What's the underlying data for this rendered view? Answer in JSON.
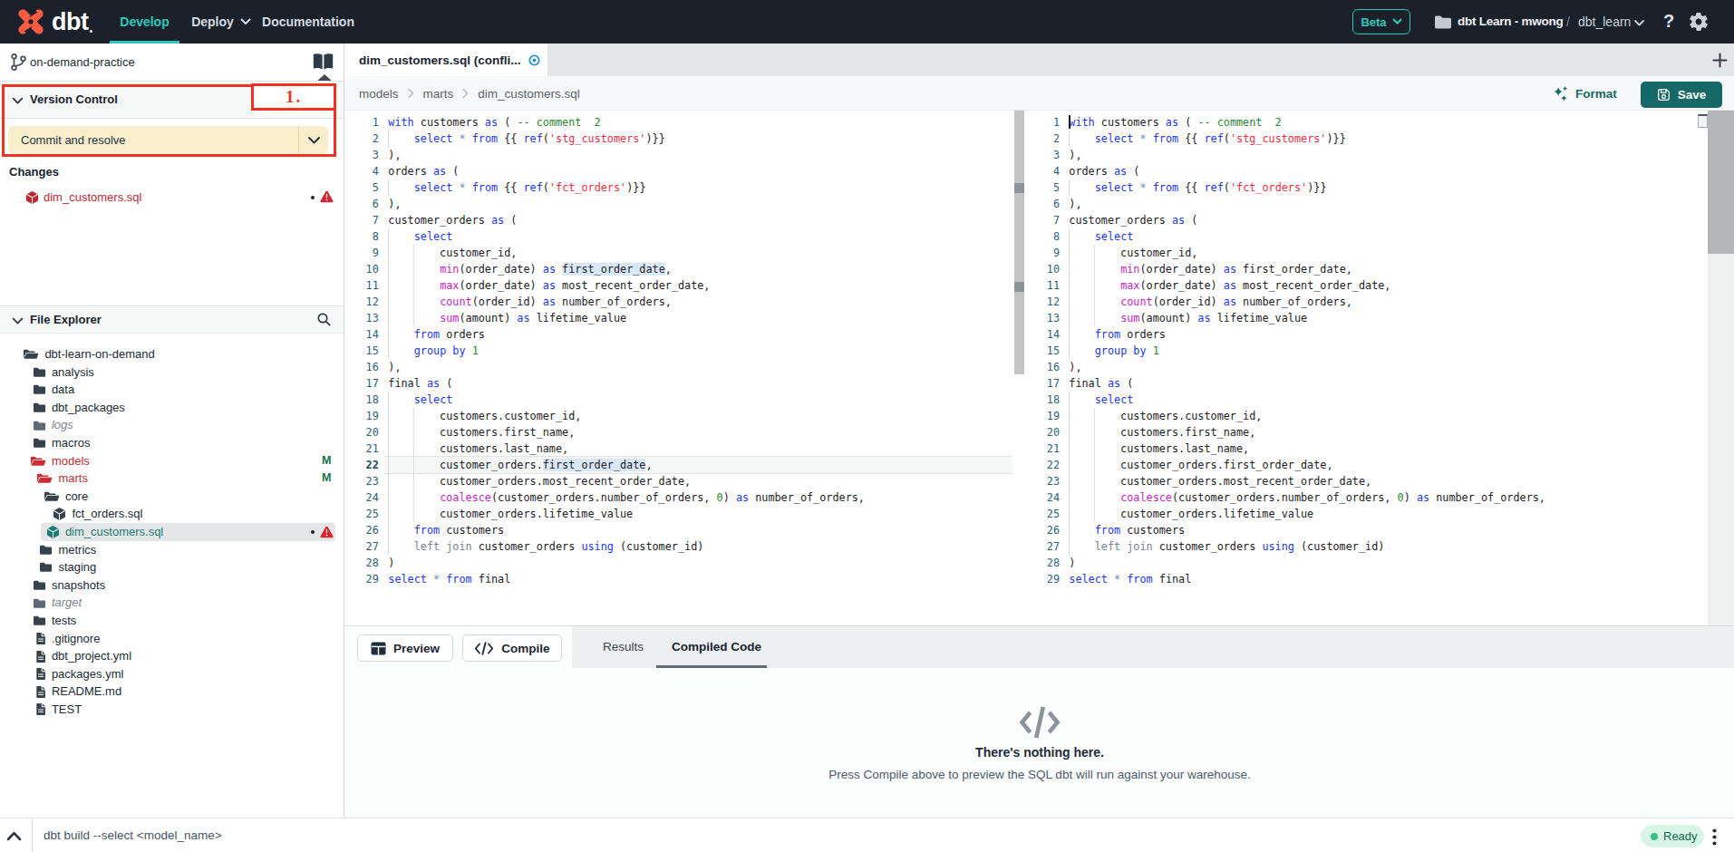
{
  "topbar": {
    "brand": "dbt",
    "nav": [
      {
        "label": "Develop"
      },
      {
        "label": "Deploy"
      },
      {
        "label": "Documentation"
      }
    ],
    "beta_label": "Beta",
    "account": "dbt Learn - mwong",
    "path_separator": "/",
    "project": "dbt_learn",
    "help_glyph": "?"
  },
  "sidebar": {
    "branch": "on-demand-practice",
    "version_control": {
      "title": "Version Control",
      "commit_button": "Commit and resolve",
      "changes_label": "Changes",
      "changed_file": "dim_customers.sql"
    },
    "annotation": {
      "label": "1.",
      "color": "#ee3322"
    },
    "file_explorer": {
      "title": "File Explorer",
      "tree": [
        {
          "name": "dbt-learn-on-demand",
          "depth": 0,
          "icon": "folder-open",
          "style": "default"
        },
        {
          "name": "analysis",
          "depth": 1,
          "icon": "folder",
          "style": "default"
        },
        {
          "name": "data",
          "depth": 1,
          "icon": "folder",
          "style": "default"
        },
        {
          "name": "dbt_packages",
          "depth": 1,
          "icon": "folder",
          "style": "default"
        },
        {
          "name": "logs",
          "depth": 1,
          "icon": "folder",
          "style": "muted"
        },
        {
          "name": "macros",
          "depth": 1,
          "icon": "folder",
          "style": "default"
        },
        {
          "name": "models",
          "depth": 1,
          "icon": "folder-open",
          "style": "red",
          "badge": "M"
        },
        {
          "name": "marts",
          "depth": 2,
          "icon": "folder-open",
          "style": "red",
          "badge": "M"
        },
        {
          "name": "core",
          "depth": 3,
          "icon": "folder-open",
          "style": "default"
        },
        {
          "name": "fct_orders.sql",
          "depth": 4,
          "icon": "cube",
          "style": "default"
        },
        {
          "name": "dim_customers.sql",
          "depth": 3,
          "icon": "cube",
          "style": "selected",
          "markers": true
        },
        {
          "name": "metrics",
          "depth": 2,
          "icon": "folder",
          "style": "default"
        },
        {
          "name": "staging",
          "depth": 2,
          "icon": "folder",
          "style": "default"
        },
        {
          "name": "snapshots",
          "depth": 1,
          "icon": "folder",
          "style": "default"
        },
        {
          "name": "target",
          "depth": 1,
          "icon": "folder",
          "style": "muted"
        },
        {
          "name": "tests",
          "depth": 1,
          "icon": "folder",
          "style": "default"
        },
        {
          "name": ".gitignore",
          "depth": 1,
          "icon": "file",
          "style": "default"
        },
        {
          "name": "dbt_project.yml",
          "depth": 1,
          "icon": "file",
          "style": "default"
        },
        {
          "name": "packages.yml",
          "depth": 1,
          "icon": "file",
          "style": "default"
        },
        {
          "name": "README.md",
          "depth": 1,
          "icon": "file",
          "style": "default"
        },
        {
          "name": "TEST",
          "depth": 1,
          "icon": "file",
          "style": "default"
        }
      ]
    }
  },
  "main": {
    "tab_title": "dim_customers.sql (confli...",
    "breadcrumbs": [
      "models",
      "marts",
      "dim_customers.sql"
    ],
    "format_label": "Format",
    "save_label": "Save"
  },
  "editor": {
    "active_line": 22,
    "cursor_line": 1,
    "lines": [
      [
        [
          "k",
          "with"
        ],
        [
          "p",
          " customers "
        ],
        [
          "k",
          "as"
        ],
        [
          "p",
          " ( "
        ],
        [
          "c",
          "-- comment  2"
        ]
      ],
      [
        [
          "p",
          "    "
        ],
        [
          "k",
          "select"
        ],
        [
          "p",
          " "
        ],
        [
          "o",
          "*"
        ],
        [
          "p",
          " "
        ],
        [
          "k",
          "from"
        ],
        [
          "p",
          " {{ "
        ],
        [
          "k",
          "ref"
        ],
        [
          "p",
          "("
        ],
        [
          "s",
          "'stg_customers'"
        ],
        [
          "p",
          ")}}"
        ]
      ],
      [
        [
          "p",
          "),"
        ]
      ],
      [
        [
          "p",
          "orders "
        ],
        [
          "k",
          "as"
        ],
        [
          "p",
          " ("
        ]
      ],
      [
        [
          "p",
          "    "
        ],
        [
          "k",
          "select"
        ],
        [
          "p",
          " "
        ],
        [
          "o",
          "*"
        ],
        [
          "p",
          " "
        ],
        [
          "k",
          "from"
        ],
        [
          "p",
          " {{ "
        ],
        [
          "k",
          "ref"
        ],
        [
          "p",
          "("
        ],
        [
          "s",
          "'fct_orders'"
        ],
        [
          "p",
          ")}}"
        ]
      ],
      [
        [
          "p",
          "),"
        ]
      ],
      [
        [
          "p",
          "customer_orders "
        ],
        [
          "k",
          "as"
        ],
        [
          "p",
          " ("
        ]
      ],
      [
        [
          "p",
          "    "
        ],
        [
          "k",
          "select"
        ]
      ],
      [
        [
          "p",
          "        customer_id,"
        ]
      ],
      [
        [
          "p",
          "        "
        ],
        [
          "f",
          "min"
        ],
        [
          "p",
          "(order_date) "
        ],
        [
          "k",
          "as"
        ],
        [
          "p",
          " "
        ],
        [
          "h",
          "first_order_date"
        ],
        [
          "p",
          ","
        ]
      ],
      [
        [
          "p",
          "        "
        ],
        [
          "f",
          "max"
        ],
        [
          "p",
          "(order_date) "
        ],
        [
          "k",
          "as"
        ],
        [
          "p",
          " most_recent_order_date,"
        ]
      ],
      [
        [
          "p",
          "        "
        ],
        [
          "f",
          "count"
        ],
        [
          "p",
          "(order_id) "
        ],
        [
          "k",
          "as"
        ],
        [
          "p",
          " number_of_orders,"
        ]
      ],
      [
        [
          "p",
          "        "
        ],
        [
          "f",
          "sum"
        ],
        [
          "p",
          "(amount) "
        ],
        [
          "k",
          "as"
        ],
        [
          "p",
          " lifetime_value"
        ]
      ],
      [
        [
          "p",
          "    "
        ],
        [
          "k",
          "from"
        ],
        [
          "p",
          " orders"
        ]
      ],
      [
        [
          "p",
          "    "
        ],
        [
          "k",
          "group by"
        ],
        [
          "p",
          " "
        ],
        [
          "n",
          "1"
        ]
      ],
      [
        [
          "p",
          "),"
        ]
      ],
      [
        [
          "p",
          "final "
        ],
        [
          "k",
          "as"
        ],
        [
          "p",
          " ("
        ]
      ],
      [
        [
          "p",
          "    "
        ],
        [
          "k",
          "select"
        ]
      ],
      [
        [
          "p",
          "        customers.customer_id,"
        ]
      ],
      [
        [
          "p",
          "        customers.first_name,"
        ]
      ],
      [
        [
          "p",
          "        customers.last_name,"
        ]
      ],
      [
        [
          "p",
          "        customer_orders."
        ],
        [
          "h",
          "first_order_date"
        ],
        [
          "p",
          ","
        ]
      ],
      [
        [
          "p",
          "        customer_orders.most_recent_order_date,"
        ]
      ],
      [
        [
          "p",
          "        "
        ],
        [
          "f",
          "coalesce"
        ],
        [
          "p",
          "(customer_orders.number_of_orders, "
        ],
        [
          "n",
          "0"
        ],
        [
          "p",
          ") "
        ],
        [
          "k",
          "as"
        ],
        [
          "p",
          " number_of_orders,"
        ]
      ],
      [
        [
          "p",
          "        customer_orders.lifetime_value"
        ]
      ],
      [
        [
          "p",
          "    "
        ],
        [
          "k",
          "from"
        ],
        [
          "p",
          " customers"
        ]
      ],
      [
        [
          "p",
          "    "
        ],
        [
          "g",
          "left join"
        ],
        [
          "p",
          " customer_orders "
        ],
        [
          "k",
          "using"
        ],
        [
          "p",
          " (customer_id)"
        ]
      ],
      [
        [
          "p",
          ")"
        ]
      ],
      [
        [
          "k",
          "select"
        ],
        [
          "p",
          " "
        ],
        [
          "o",
          "*"
        ],
        [
          "p",
          " "
        ],
        [
          "k",
          "from"
        ],
        [
          "p",
          " final"
        ]
      ]
    ]
  },
  "bottom": {
    "preview_label": "Preview",
    "compile_label": "Compile",
    "tabs": [
      {
        "label": "Results",
        "active": false
      },
      {
        "label": "Compiled Code",
        "active": true
      }
    ],
    "empty_title": "There's nothing here.",
    "empty_subtitle": "Press Compile above to preview the SQL dbt will run against your warehouse."
  },
  "statusbar": {
    "command": "dbt build --select <model_name>",
    "ready_label": "Ready"
  },
  "colors": {
    "brand_orange": "#ff5c42",
    "accent_teal": "#2cc9bb",
    "annotation_red": "#ee3322",
    "save_teal": "#166866",
    "ready_green": "#36c088",
    "warning_red": "#d6252f",
    "modified_badge_green": "#15724c",
    "changed_file_red": "#b92c32",
    "selected_file_teal": "#1c7b74"
  }
}
